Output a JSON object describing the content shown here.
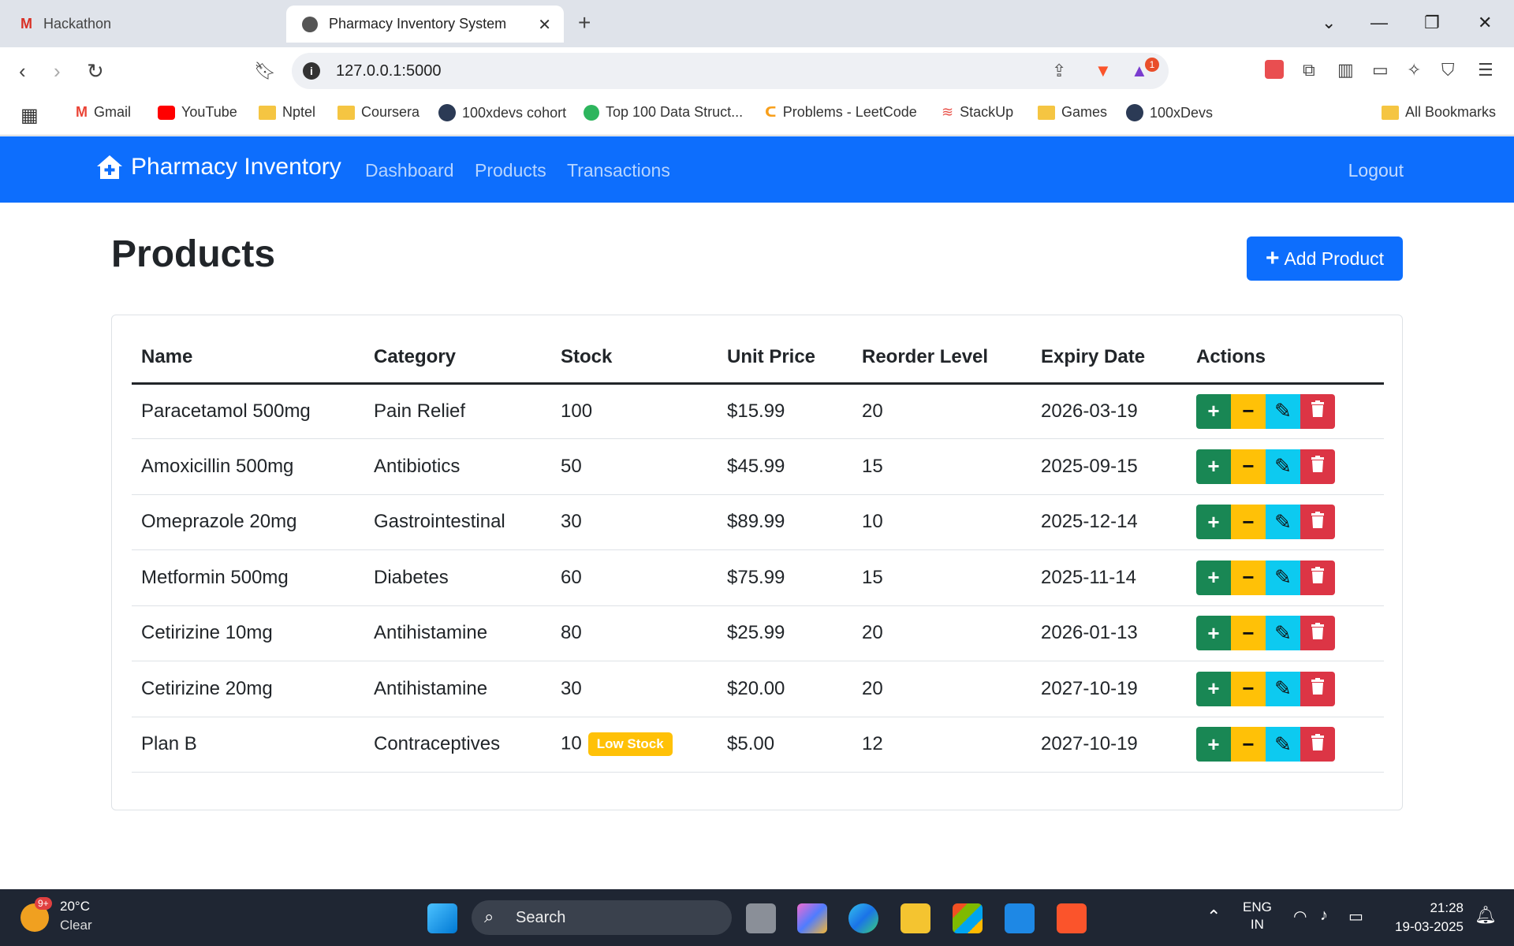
{
  "browser": {
    "tabs": [
      {
        "title": "Hackathon",
        "active": false
      },
      {
        "title": "Pharmacy Inventory System",
        "active": true
      }
    ],
    "url": "127.0.0.1:5000",
    "brave_badge": "1",
    "bookmarks": [
      {
        "label": "Gmail",
        "icon": "gmail-icon"
      },
      {
        "label": "YouTube",
        "icon": "youtube-icon"
      },
      {
        "label": "Nptel",
        "icon": "folder-icon"
      },
      {
        "label": "Coursera",
        "icon": "folder-icon"
      },
      {
        "label": "100xdevs cohort",
        "icon": "avatar-icon"
      },
      {
        "label": "Top 100 Data Struct...",
        "icon": "site-icon"
      },
      {
        "label": "Problems - LeetCode",
        "icon": "leetcode-icon"
      },
      {
        "label": "StackUp",
        "icon": "stackup-icon"
      },
      {
        "label": "Games",
        "icon": "folder-icon"
      },
      {
        "label": "100xDevs",
        "icon": "avatar-icon"
      }
    ],
    "all_bookmarks": "All Bookmarks"
  },
  "navbar": {
    "brand": "Pharmacy Inventory",
    "links": [
      "Dashboard",
      "Products",
      "Transactions"
    ],
    "logout": "Logout"
  },
  "page": {
    "title": "Products",
    "add_button": "Add Product"
  },
  "table": {
    "headers": [
      "Name",
      "Category",
      "Stock",
      "Unit Price",
      "Reorder Level",
      "Expiry Date",
      "Actions"
    ],
    "rows": [
      {
        "name": "Paracetamol 500mg",
        "category": "Pain Relief",
        "stock": "100",
        "price": "$15.99",
        "reorder": "20",
        "expiry": "2026-03-19",
        "badge": ""
      },
      {
        "name": "Amoxicillin 500mg",
        "category": "Antibiotics",
        "stock": "50",
        "price": "$45.99",
        "reorder": "15",
        "expiry": "2025-09-15",
        "badge": ""
      },
      {
        "name": "Omeprazole 20mg",
        "category": "Gastrointestinal",
        "stock": "30",
        "price": "$89.99",
        "reorder": "10",
        "expiry": "2025-12-14",
        "badge": ""
      },
      {
        "name": "Metformin 500mg",
        "category": "Diabetes",
        "stock": "60",
        "price": "$75.99",
        "reorder": "15",
        "expiry": "2025-11-14",
        "badge": ""
      },
      {
        "name": "Cetirizine 10mg",
        "category": "Antihistamine",
        "stock": "80",
        "price": "$25.99",
        "reorder": "20",
        "expiry": "2026-01-13",
        "badge": ""
      },
      {
        "name": "Cetirizine 20mg",
        "category": "Antihistamine",
        "stock": "30",
        "price": "$20.00",
        "reorder": "20",
        "expiry": "2027-10-19",
        "badge": ""
      },
      {
        "name": "Plan B",
        "category": "Contraceptives",
        "stock": "10",
        "price": "$5.00",
        "reorder": "12",
        "expiry": "2027-10-19",
        "badge": "Low Stock"
      }
    ]
  },
  "taskbar": {
    "weather_badge": "9+",
    "temperature": "20°C",
    "condition": "Clear",
    "search": "Search",
    "lang_top": "ENG",
    "lang_bottom": "IN",
    "time": "21:28",
    "date": "19-03-2025"
  },
  "colors": {
    "primary": "#0d6efd",
    "success": "#198754",
    "warning": "#ffc107",
    "info": "#0dcaf0",
    "danger": "#dc3545"
  }
}
